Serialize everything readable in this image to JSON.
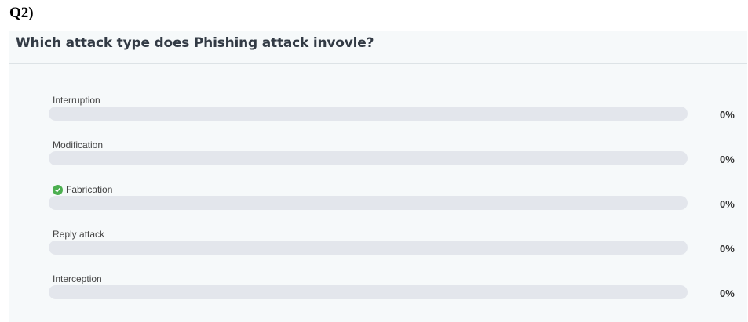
{
  "question_number": "Q2)",
  "question": "Which attack type does Phishing attack invovle?",
  "options": [
    {
      "label": "Interruption",
      "percent": "0%",
      "fill": 0,
      "correct": false
    },
    {
      "label": "Modification",
      "percent": "0%",
      "fill": 0,
      "correct": false
    },
    {
      "label": "Fabrication",
      "percent": "0%",
      "fill": 0,
      "correct": true
    },
    {
      "label": "Reply attack",
      "percent": "0%",
      "fill": 0,
      "correct": false
    },
    {
      "label": "Interception",
      "percent": "0%",
      "fill": 0,
      "correct": false
    }
  ],
  "colors": {
    "correct": "#4caf50",
    "track": "#e3e6ec",
    "card_bg": "#f6f9fa"
  },
  "icons": {
    "correct_marker": "check-circle-icon"
  }
}
